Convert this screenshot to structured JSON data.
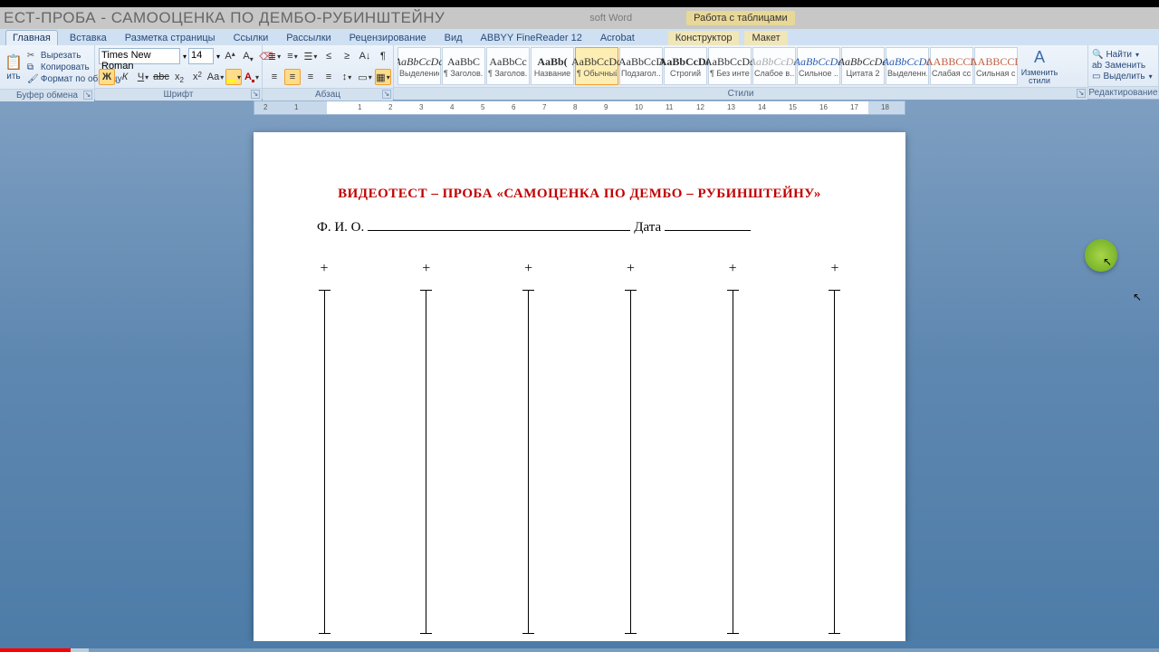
{
  "window": {
    "doc_title": "ЕСТ-ПРОБА - САМООЦЕНКА ПО ДЕМБО-РУБИНШТЕЙНУ",
    "app_suffix": "soft Word",
    "table_tools": "Работа с таблицами"
  },
  "tabs": {
    "items": [
      "Главная",
      "Вставка",
      "Разметка страницы",
      "Ссылки",
      "Рассылки",
      "Рецензирование",
      "Вид",
      "ABBYY FineReader 12",
      "Acrobat"
    ],
    "table_tabs": [
      "Конструктор",
      "Макет"
    ],
    "active": "Главная"
  },
  "clipboard": {
    "paste": "ить",
    "cut": "Вырезать",
    "copy": "Копировать",
    "format": "Формат по образцу",
    "group": "Буфер обмена"
  },
  "font": {
    "name": "Times New Roman",
    "size": "14",
    "group": "Шрифт"
  },
  "paragraph": {
    "group": "Абзац"
  },
  "styles": {
    "group": "Стили",
    "items": [
      {
        "prev": "AaBbCcDd",
        "label": "Выделение",
        "italic": true
      },
      {
        "prev": "AaBbC",
        "label": "¶ Заголов..."
      },
      {
        "prev": "AaBbCc",
        "label": "¶ Заголов..."
      },
      {
        "prev": "AaBb(",
        "label": "Название",
        "bold": true
      },
      {
        "prev": "AaBbCcDd",
        "label": "¶ Обычный",
        "selected": true
      },
      {
        "prev": "AaBbCcD",
        "label": "Подзагол..."
      },
      {
        "prev": "AaBbCcDd",
        "label": "Строгий",
        "bold": true
      },
      {
        "prev": "AaBbCcDd",
        "label": "¶ Без инте..."
      },
      {
        "prev": "AaBbCcDd",
        "label": "Слабое в...",
        "italic": true,
        "dim": true
      },
      {
        "prev": "AaBbCcDd",
        "label": "Сильное ...",
        "italic": true,
        "color": "#2a5db0"
      },
      {
        "prev": "AaBbCcDd",
        "label": "Цитата 2",
        "italic": true
      },
      {
        "prev": "AaBbCcDd",
        "label": "Выделенн...",
        "italic": true,
        "color": "#2a5db0"
      },
      {
        "prev": "AABBCCD",
        "label": "Слабая сс...",
        "color": "#c06040"
      },
      {
        "prev": "AABBCCD",
        "label": "Сильная с...",
        "color": "#c06040"
      }
    ],
    "change": "Изменить\nстили"
  },
  "editing": {
    "find": "Найти",
    "replace": "Заменить",
    "select": "Выделить",
    "group": "Редактирование"
  },
  "ruler": {
    "left_margin_nums": [
      "2",
      "1"
    ],
    "nums": [
      "1",
      "2",
      "3",
      "4",
      "5",
      "6",
      "7",
      "8",
      "9",
      "10",
      "11",
      "12",
      "13",
      "14",
      "15",
      "16",
      "17",
      "18"
    ]
  },
  "document": {
    "heading": "ВИДЕОТЕСТ – ПРОБА «САМОЦЕНКА ПО ДЕМБО – РУБИНШТЕЙНУ»",
    "fio_label": "Ф. И. О.",
    "date_label": "Дата",
    "plus": "+"
  }
}
